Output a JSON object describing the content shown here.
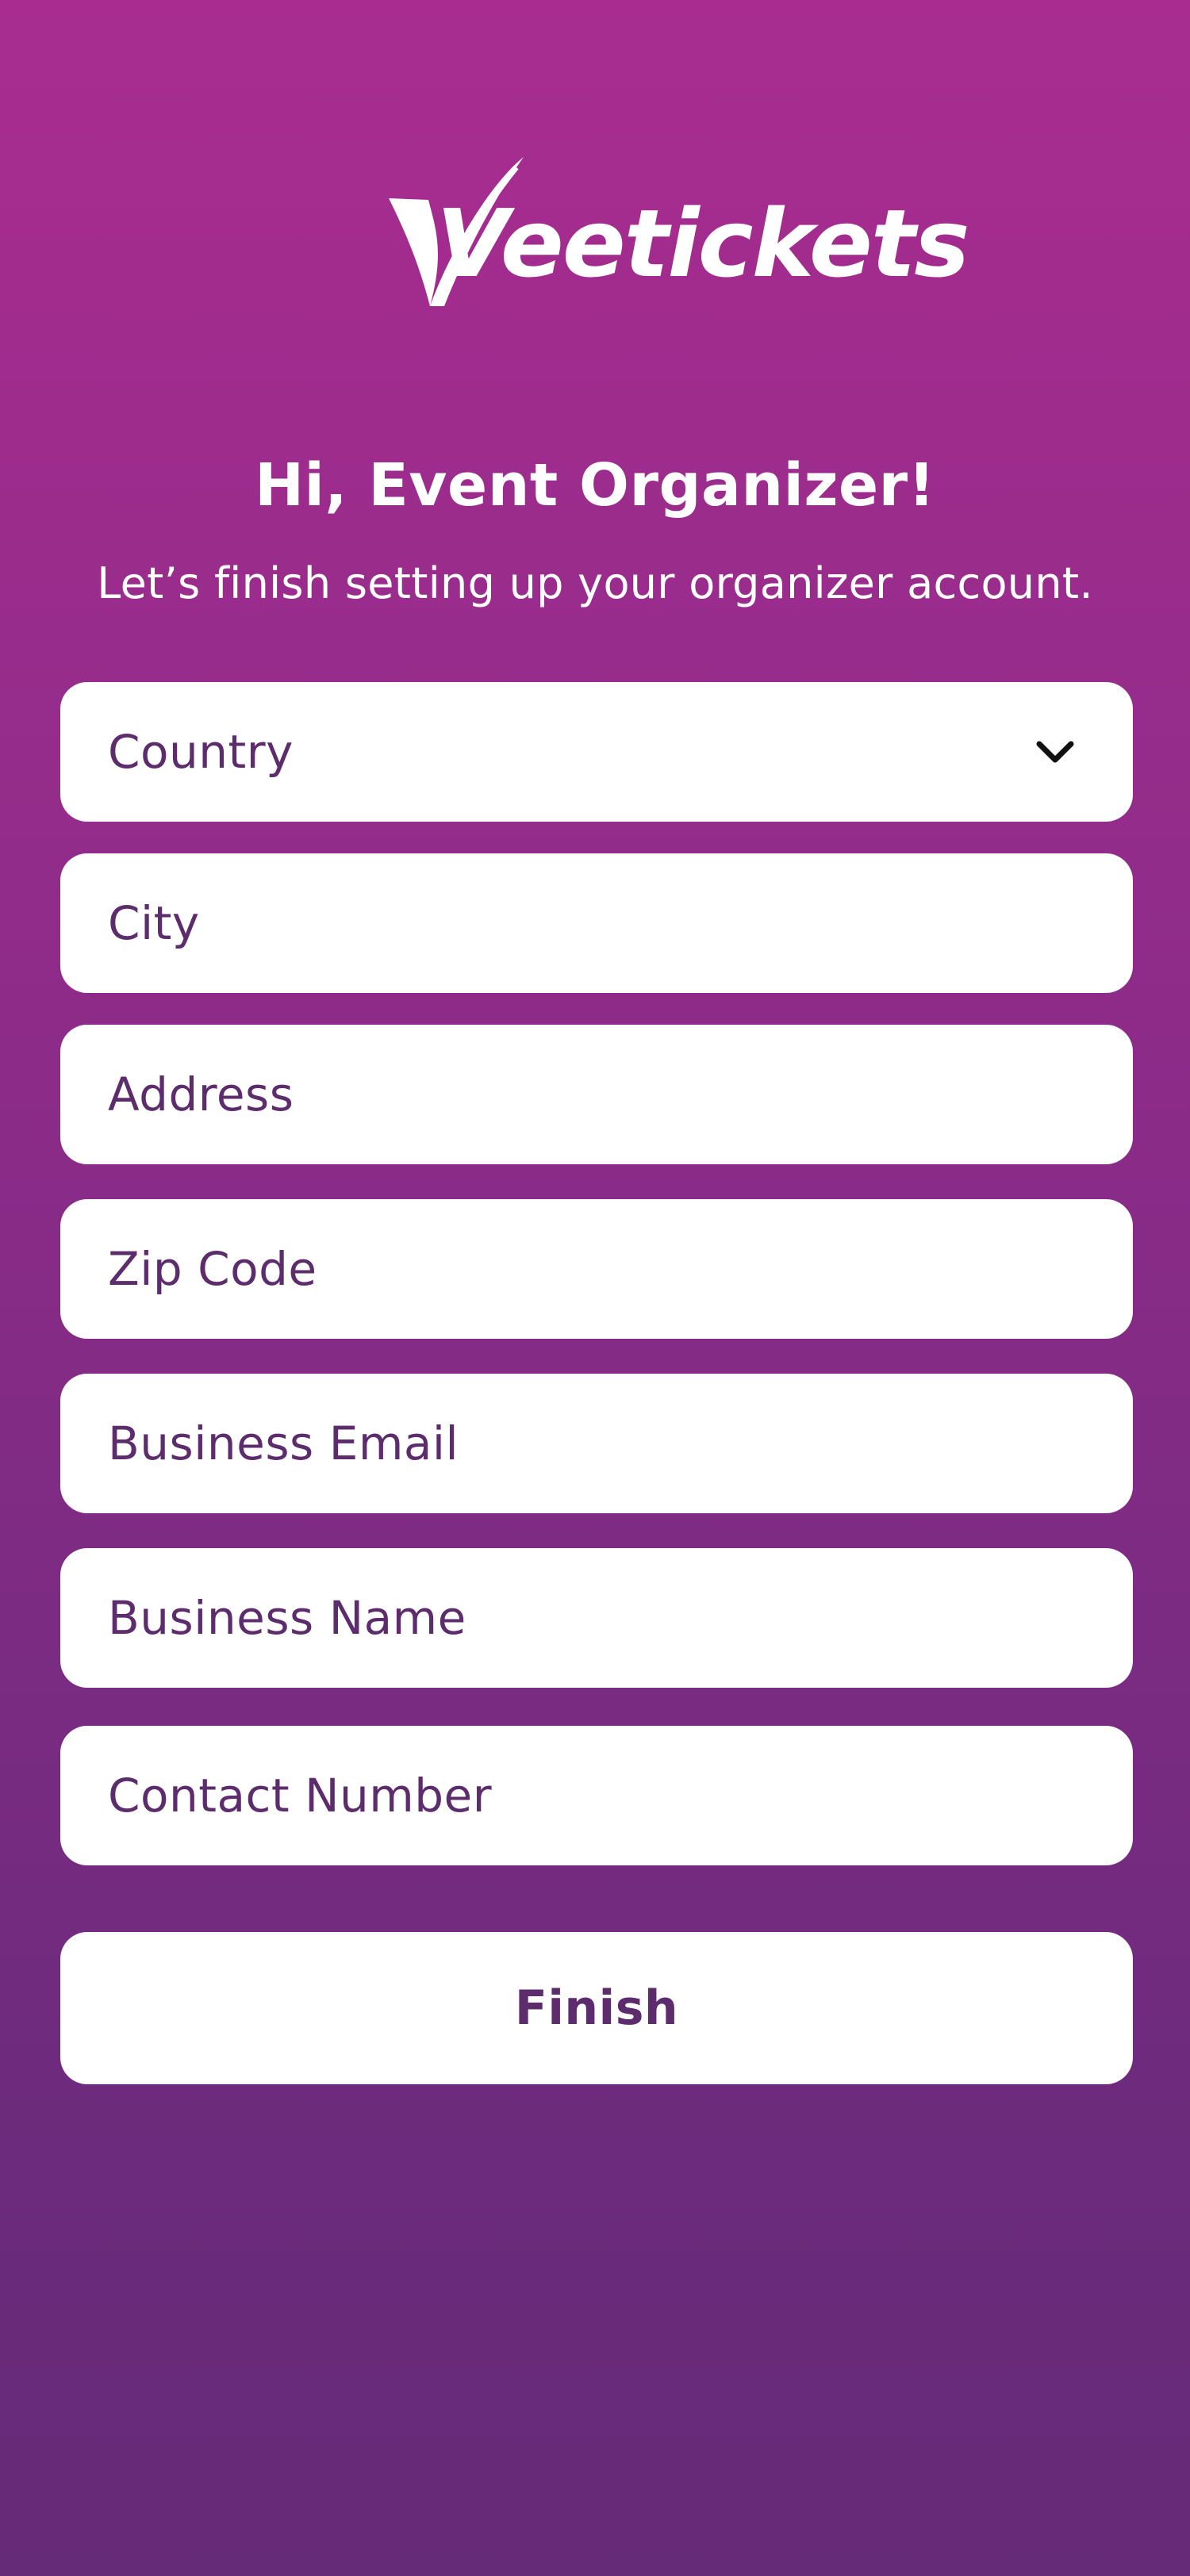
{
  "app": {
    "logo_text": "Veetickets"
  },
  "header": {
    "title": "Hi, Event Organizer!",
    "subtitle": "Let’s finish setting up your organizer account."
  },
  "form": {
    "country": {
      "placeholder": "Country",
      "icon": "chevron-down-icon"
    },
    "city": {
      "placeholder": "City"
    },
    "address": {
      "placeholder": "Address"
    },
    "zip_code": {
      "placeholder": "Zip Code"
    },
    "business_email": {
      "placeholder": "Business Email"
    },
    "business_name": {
      "placeholder": "Business Name"
    },
    "contact_number": {
      "placeholder": "Contact Number"
    },
    "finish_label": "Finish"
  },
  "colors": {
    "background_top": "#A92D90",
    "background_bottom": "#652A78",
    "field_text": "#5C2C6C",
    "field_background": "#FFFFFF"
  }
}
